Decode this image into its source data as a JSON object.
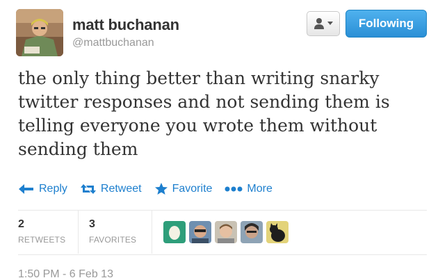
{
  "user": {
    "fullname": "matt buchanan",
    "username": "@mattbuchanan"
  },
  "follow_button": {
    "label": "Following",
    "color": "#2a8fd6"
  },
  "user_menu": {
    "icon": "person-icon"
  },
  "tweet": {
    "lines": [
      "the only thing better than writing snarky",
      "twitter responses and not sending them is",
      "telling everyone you wrote them without",
      "sending them"
    ]
  },
  "actions": {
    "reply": "Reply",
    "retweet": "Retweet",
    "favorite": "Favorite",
    "more": "More"
  },
  "stats": {
    "retweets_count": "2",
    "retweets_label": "RETWEETS",
    "favorites_count": "3",
    "favorites_label": "FAVORITES"
  },
  "timestamp": "1:50 PM - 6 Feb 13",
  "colors": {
    "link": "#1d7fce",
    "muted": "#999999",
    "text": "#333333"
  }
}
